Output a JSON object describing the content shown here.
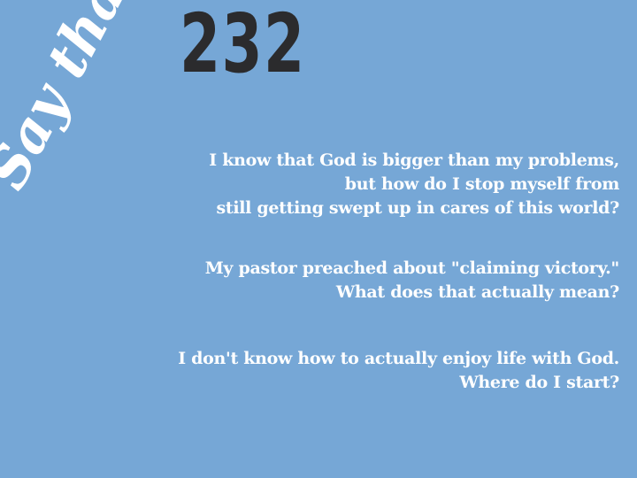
{
  "logo": {
    "script_text": "Say that!",
    "episode_number": "232"
  },
  "questions": [
    {
      "lines": [
        "I know that God is bigger than my problems,",
        "but how do I stop myself from",
        "still getting swept up in cares of this world?"
      ]
    },
    {
      "lines": [
        "My pastor preached about \"claiming victory.\"",
        "What does that actually mean?"
      ]
    },
    {
      "lines": [
        "I don't know how to actually enjoy life with God.",
        "Where do I start?"
      ]
    }
  ],
  "colors": {
    "background": "#76a7d6",
    "number": "#2b2b2d",
    "text": "#ffffff"
  }
}
